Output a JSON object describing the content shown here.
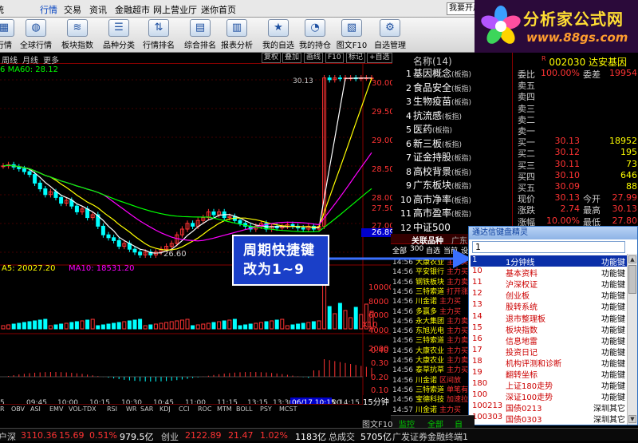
{
  "menubar": {
    "items": [
      "行情",
      "交易",
      "资讯",
      "金融超市",
      "网上营业厅",
      "迷你首页"
    ],
    "search_placeholder": "我要开户"
  },
  "toolbar": {
    "buttons": [
      {
        "label": "行情",
        "icon": "market-icon"
      },
      {
        "label": "全球行情",
        "icon": "globe-icon"
      },
      {
        "label": "板块指数",
        "icon": "sector-index-icon"
      },
      {
        "label": "品种分类",
        "icon": "category-icon"
      },
      {
        "label": "行情排名",
        "icon": "ranking-icon"
      },
      {
        "label": "综合排名",
        "icon": "overall-ranking-icon"
      },
      {
        "label": "报表分析",
        "icon": "report-icon"
      },
      {
        "label": "我的自选",
        "icon": "my-watchlist-icon"
      },
      {
        "label": "我的持仓",
        "icon": "my-position-icon"
      },
      {
        "label": "图文F10",
        "icon": "f10-icon"
      },
      {
        "label": "自选管理",
        "icon": "watchlist-manage-icon"
      }
    ]
  },
  "logo": {
    "title": "分析家公式网",
    "url": "www.88gs.com"
  },
  "chartbar": {
    "periods": [
      "周线",
      "月线",
      "更多"
    ],
    "buttons": [
      "复权",
      "叠加",
      "画线",
      "F10",
      "标记",
      "+自选"
    ]
  },
  "ma_text": {
    "prefix": "6",
    "ma60": "MA60: 28.12"
  },
  "price_axis": [
    "30.00",
    "29.50",
    "29.00",
    "28.50",
    "28.00",
    "27.50",
    "27.00",
    "26.89"
  ],
  "price_labels": {
    "high": "30.13",
    "low": "26.60"
  },
  "volume_text": {
    "ma5": "A5: 20027.20",
    "ma10": "MA10: 18531.20"
  },
  "vol_axis": [
    "10000",
    "8000",
    "6000",
    "4000",
    "2000",
    "X10"
  ],
  "macd_axis": [
    "0.40",
    "0.30",
    "0.20",
    "0.10",
    "0.00",
    "-0.10"
  ],
  "time_axis": [
    "5",
    "09:45",
    "10:00",
    "10:15",
    "10:30",
    "10:45",
    "11:00",
    "11:15",
    "13:15",
    "13:30",
    "13:45",
    "14:00",
    "14:15",
    "14:30",
    "14:45",
    "15:00",
    "06/17 10:15"
  ],
  "period_label": "15分钟",
  "indicators": [
    "R",
    "OBV",
    "ASI",
    "EMV",
    "VOL-TDX",
    "RSI",
    "WR",
    "SAR",
    "KDJ",
    "CCI",
    "ROC",
    "MTM",
    "BOLL",
    "PSY",
    "MCST"
  ],
  "rlist": {
    "header": "名称(14)",
    "items": [
      {
        "n": "1",
        "name": "基因概念",
        "tag": "(板指)"
      },
      {
        "n": "2",
        "name": "食品安全",
        "tag": "(板指)"
      },
      {
        "n": "3",
        "name": "生物疫苗",
        "tag": "(板指)"
      },
      {
        "n": "4",
        "name": "抗流感",
        "tag": "(板指)"
      },
      {
        "n": "5",
        "name": "医药",
        "tag": "(板指)"
      },
      {
        "n": "6",
        "name": "新三板",
        "tag": "(板指)"
      },
      {
        "n": "7",
        "name": "证金持股",
        "tag": "(板指)"
      },
      {
        "n": "8",
        "name": "高校背景",
        "tag": "(板指)"
      },
      {
        "n": "9",
        "name": "广东板块",
        "tag": "(板指)"
      },
      {
        "n": "10",
        "name": "高市净率",
        "tag": "(板指)"
      },
      {
        "n": "11",
        "name": "高市盈率",
        "tag": "(板指)"
      },
      {
        "n": "12",
        "name": "中证500",
        "tag": ""
      }
    ]
  },
  "quote": {
    "code": "002030",
    "name": "达安基因",
    "rows": [
      {
        "k": "委比",
        "v": "100.00%",
        "k2": "委差",
        "v2": "19954",
        "c": "#ff3333"
      },
      {
        "k": "卖五",
        "v": "",
        "v2": "",
        "c": "#ccc"
      },
      {
        "k": "卖四",
        "v": "",
        "v2": "",
        "c": "#ccc"
      },
      {
        "k": "卖三",
        "v": "",
        "v2": "",
        "c": "#ccc"
      },
      {
        "k": "卖二",
        "v": "",
        "v2": "",
        "c": "#ccc"
      },
      {
        "k": "卖一",
        "v": "",
        "v2": "",
        "c": "#ccc"
      },
      {
        "k": "买一",
        "v": "30.13",
        "v2": "18952",
        "c": "#ff3333"
      },
      {
        "k": "买二",
        "v": "30.12",
        "v2": "195",
        "c": "#ff3333"
      },
      {
        "k": "买三",
        "v": "30.11",
        "v2": "73",
        "c": "#ff3333"
      },
      {
        "k": "买四",
        "v": "30.10",
        "v2": "646",
        "c": "#ff3333"
      },
      {
        "k": "买五",
        "v": "30.09",
        "v2": "88",
        "c": "#ff3333"
      },
      {
        "k": "现价",
        "v": "30.13",
        "k2": "今开",
        "v2": "27.99",
        "c": "#ff3333"
      },
      {
        "k": "涨跌",
        "v": "2.74",
        "k2": "最高",
        "v2": "30.13",
        "c": "#ff3333"
      },
      {
        "k": "涨幅",
        "v": "10.00%",
        "k2": "最低",
        "v2": "27.80",
        "c": "#ff3333"
      }
    ]
  },
  "annotation": {
    "line1": "周期快捷键",
    "line2": "改为1~9"
  },
  "assoc": {
    "header": "关联品种",
    "header2": "广东",
    "tabs": [
      "全部",
      "300",
      "自选",
      "当前",
      "设"
    ],
    "rows": [
      {
        "t": "14:56",
        "n": "大康农业",
        "d": "主力买"
      },
      {
        "t": "14:56",
        "n": "平安银行",
        "d": "主力买"
      },
      {
        "t": "14:56",
        "n": "钢铁板块",
        "d": "主力卖"
      },
      {
        "t": "14:56",
        "n": "三特索道",
        "d": "打开涨"
      },
      {
        "t": "14:56",
        "n": "川金诺",
        "d": "主力买"
      },
      {
        "t": "14:56",
        "n": "多赢多",
        "d": "主力买"
      },
      {
        "t": "14:56",
        "n": "永大集团",
        "d": "主力卖"
      },
      {
        "t": "14:56",
        "n": "东旭光电",
        "d": "主力买"
      },
      {
        "t": "14:56",
        "n": "三特索道",
        "d": "主力卖"
      },
      {
        "t": "14:56",
        "n": "大康农业",
        "d": "主力买"
      },
      {
        "t": "14:56",
        "n": "大康农业",
        "d": "主力卖"
      },
      {
        "t": "14:56",
        "n": "泰草抗草",
        "d": "主力买"
      },
      {
        "t": "14:56",
        "n": "川金诺",
        "d": "区间放"
      },
      {
        "t": "14:56",
        "n": "三特索道",
        "d": "单笔有"
      },
      {
        "t": "14:56",
        "n": "宝德科技",
        "d": "加速拉"
      },
      {
        "t": "14:57",
        "n": "川金诺",
        "d": "主力买"
      }
    ]
  },
  "popup": {
    "title": "通达信键盘精灵",
    "input": "1",
    "rows": [
      {
        "c1": "1",
        "c2": "1分钟线",
        "c3": "功能键"
      },
      {
        "c1": "10",
        "c2": "基本资料",
        "c3": "功能键"
      },
      {
        "c1": "11",
        "c2": "沪深权证",
        "c3": "功能键"
      },
      {
        "c1": "12",
        "c2": "创业板",
        "c3": "功能键"
      },
      {
        "c1": "13",
        "c2": "股转系统",
        "c3": "功能键"
      },
      {
        "c1": "14",
        "c2": "退市整理板",
        "c3": "功能键"
      },
      {
        "c1": "15",
        "c2": "板块指数",
        "c3": "功能键"
      },
      {
        "c1": "16",
        "c2": "信息地雷",
        "c3": "功能键"
      },
      {
        "c1": "17",
        "c2": "投资日记",
        "c3": "功能键"
      },
      {
        "c1": "18",
        "c2": "机构评测和诊断",
        "c3": "功能键"
      },
      {
        "c1": "19",
        "c2": "翻转坐标",
        "c3": "功能键"
      },
      {
        "c1": "180",
        "c2": "上证180走势",
        "c3": "功能键"
      },
      {
        "c1": "100",
        "c2": "深证100走势",
        "c3": "功能键"
      },
      {
        "c1": "100213",
        "c2": "国债0213",
        "c3": "深圳其它"
      },
      {
        "c1": "100303",
        "c2": "国债0303",
        "c3": "深圳其它"
      }
    ]
  },
  "bottom_tabs": [
    "图文F10",
    "监控",
    "全部",
    "自"
  ],
  "status": {
    "items": [
      {
        "t": "户深",
        "c": "#ccc"
      },
      {
        "t": "3110.36",
        "c": "#ff3333"
      },
      {
        "t": "15.69",
        "c": "#ff3333"
      },
      {
        "t": "0.51%",
        "c": "#ff3333"
      },
      {
        "t": "979.5亿",
        "c": "#ffffff"
      },
      {
        "t": "创业",
        "c": "#ccc"
      },
      {
        "t": "2122.89",
        "c": "#ff3333"
      },
      {
        "t": "21.47",
        "c": "#ff3333"
      },
      {
        "t": "1.02%",
        "c": "#ff3333"
      },
      {
        "t": "1183亿",
        "c": "#ffffff"
      },
      {
        "t": "总成交",
        "c": "#ccc"
      },
      {
        "t": "5705亿",
        "c": "#ffffff"
      },
      {
        "t": "广发证券金融终端1",
        "c": "#ccc"
      }
    ]
  },
  "colors": {
    "up": "#ff3333",
    "down": "#00ffff",
    "ma1": "#ffffff",
    "ma2": "#ffff00",
    "ma3": "#ff00ff",
    "ma4": "#00ff00"
  }
}
